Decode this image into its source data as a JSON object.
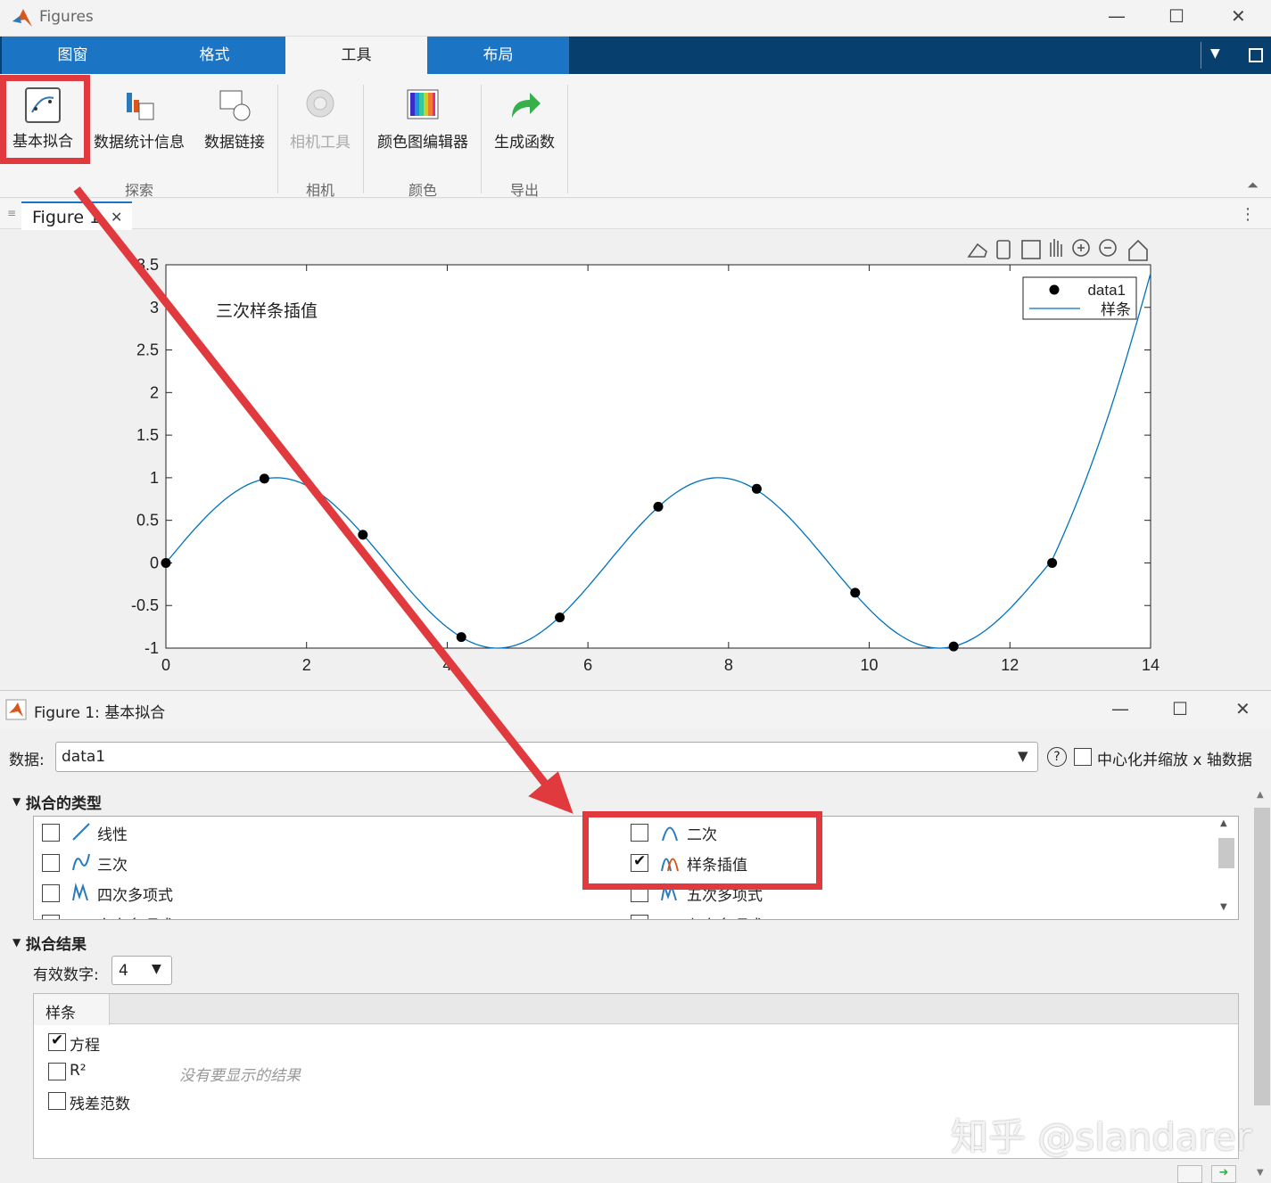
{
  "window": {
    "title": "Figures",
    "min": "—",
    "max": "☐",
    "close": "✕"
  },
  "tabs": [
    {
      "label": "图窗"
    },
    {
      "label": "格式"
    },
    {
      "label": "工具"
    },
    {
      "label": "布局"
    }
  ],
  "ribbon": {
    "buttons": [
      {
        "label": "基本拟合",
        "icon": "basic-fitting-icon"
      },
      {
        "label": "数据统计信息",
        "icon": "data-stats-icon"
      },
      {
        "label": "数据链接",
        "icon": "data-link-icon"
      },
      {
        "label": "相机工具",
        "icon": "camera-icon"
      },
      {
        "label": "颜色图编辑器",
        "icon": "colormap-icon"
      },
      {
        "label": "生成函数",
        "icon": "generate-function-icon"
      }
    ],
    "groups": [
      {
        "label": "探索"
      },
      {
        "label": "相机"
      },
      {
        "label": "颜色"
      },
      {
        "label": "导出"
      }
    ]
  },
  "figure_tab": {
    "label": "Figure 1"
  },
  "plot": {
    "annotation": "三次样条插值",
    "legend": [
      "data1",
      "样条"
    ],
    "colors": {
      "line": "#0072bd",
      "marker": "#000000"
    }
  },
  "chart_data": {
    "type": "scatter",
    "title": "",
    "xlabel": "",
    "ylabel": "",
    "xlim": [
      0,
      14
    ],
    "ylim": [
      -1,
      3.5
    ],
    "xticks": [
      "0",
      "2",
      "4",
      "6",
      "8",
      "10",
      "12",
      "14"
    ],
    "yticks": [
      "3.5",
      "3",
      "2.5",
      "2",
      "1.5",
      "1",
      "0.5",
      "0",
      "-0.5",
      "-1"
    ],
    "series": [
      {
        "name": "data1",
        "kind": "markers",
        "x": [
          0,
          1.4,
          2.8,
          4.2,
          5.6,
          7.0,
          8.4,
          9.8,
          11.2,
          12.6
        ],
        "y": [
          0,
          0.99,
          0.33,
          -0.87,
          -0.64,
          0.66,
          0.87,
          -0.35,
          -0.98,
          0.0
        ]
      },
      {
        "name": "样条",
        "kind": "spline",
        "curve": "sin",
        "xrange": [
          0,
          12.6
        ],
        "tail": [
          [
            12.6,
            0.0
          ],
          [
            13.2,
            1.1
          ],
          [
            13.6,
            2.2
          ],
          [
            14.0,
            3.4
          ]
        ]
      }
    ],
    "legend_position": "top-right",
    "grid": false
  },
  "dialog": {
    "title": "Figure 1: 基本拟合",
    "data_label": "数据:",
    "data_value": "data1",
    "help": "?",
    "center_scale": "中心化并缩放 x 轴数据",
    "fit_types_title": "拟合的类型",
    "fit_types_left": [
      {
        "label": "线性",
        "checked": false
      },
      {
        "label": "三次",
        "checked": false
      },
      {
        "label": "四次多项式",
        "checked": false
      },
      {
        "label": "六次多项式",
        "checked": false
      }
    ],
    "fit_types_right": [
      {
        "label": "二次",
        "checked": false
      },
      {
        "label": "样条插值",
        "checked": true
      },
      {
        "label": "五次多项式",
        "checked": false
      },
      {
        "label": "七次多项式",
        "checked": false
      }
    ],
    "results_title": "拟合结果",
    "sig_digits_label": "有效数字:",
    "sig_digits_value": "4",
    "results_tab": "样条",
    "opts": [
      {
        "label": "方程",
        "checked": true
      },
      {
        "label": "R²",
        "checked": false
      },
      {
        "label": "残差范数",
        "checked": false
      }
    ],
    "no_results": "没有要显示的结果"
  },
  "watermark": "知乎 @slandarer"
}
